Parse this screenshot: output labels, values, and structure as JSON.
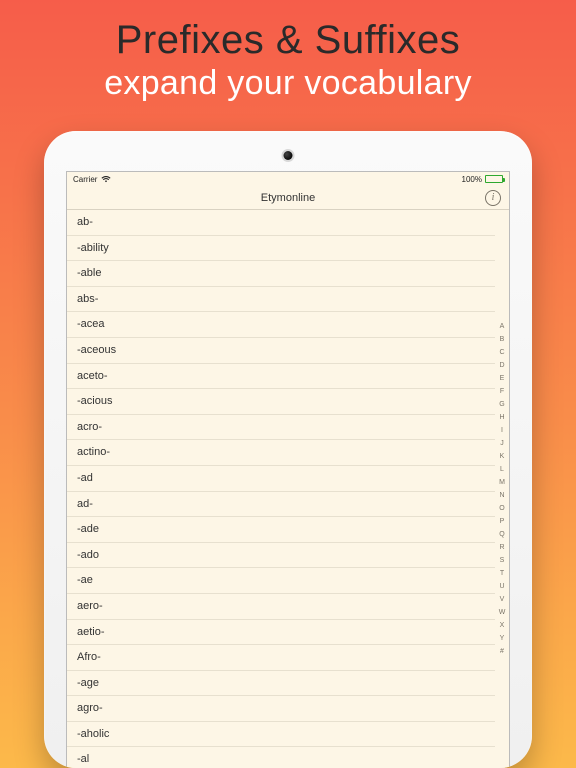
{
  "promo": {
    "title": "Prefixes & Suffixes",
    "subtitle": "expand your vocabulary"
  },
  "statusbar": {
    "carrier": "Carrier",
    "battery_text": "100%"
  },
  "navbar": {
    "title": "Etymonline",
    "info_glyph": "i"
  },
  "list": {
    "items": [
      "ab-",
      "-ability",
      "-able",
      "abs-",
      "-acea",
      "-aceous",
      "aceto-",
      "-acious",
      "acro-",
      "actino-",
      "-ad",
      "ad-",
      "-ade",
      "-ado",
      "-ae",
      "aero-",
      "aetio-",
      "Afro-",
      "-age",
      "agro-",
      "-aholic",
      "-al"
    ]
  },
  "index": {
    "letters": [
      "A",
      "B",
      "C",
      "D",
      "E",
      "F",
      "G",
      "H",
      "I",
      "J",
      "K",
      "L",
      "M",
      "N",
      "O",
      "P",
      "Q",
      "R",
      "S",
      "T",
      "U",
      "V",
      "W",
      "X",
      "Y",
      "#"
    ]
  }
}
